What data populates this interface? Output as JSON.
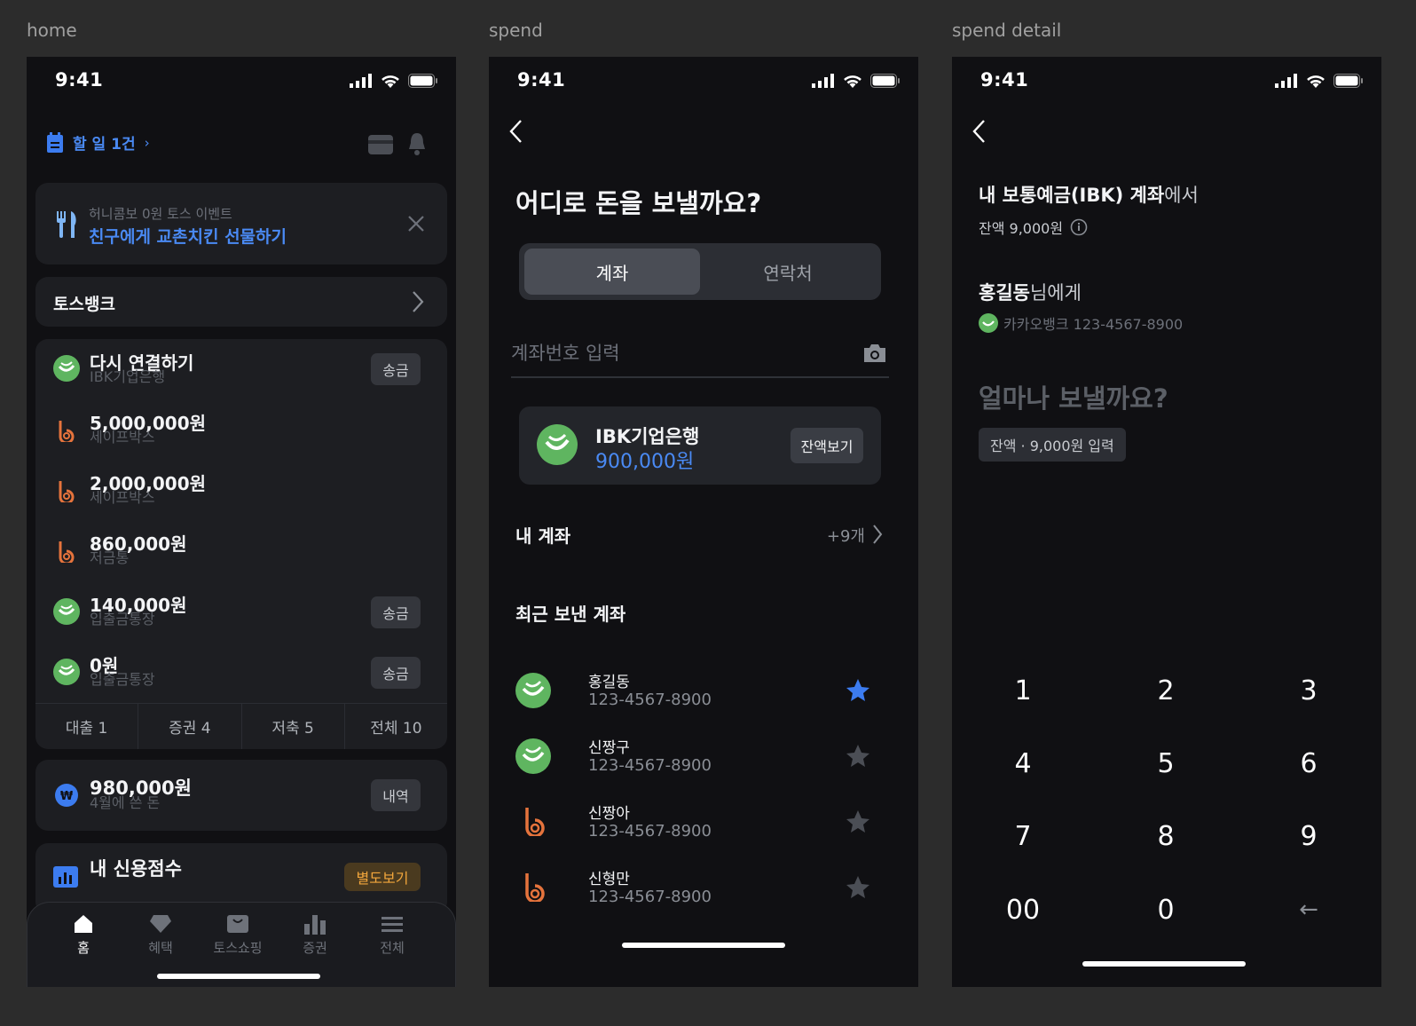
{
  "screens": {
    "home": {
      "label": "home",
      "time": "9:41",
      "todo": "할 일 1건",
      "banner": {
        "small": "허니콤보 0원 토스 이벤트",
        "main": "친구에게 교촌치킨 선물하기"
      },
      "bank_title": "토스뱅크",
      "accounts": [
        {
          "title": "다시 연결하기",
          "sub": "IBK기업은행",
          "action": "송금",
          "icon": "ibk-logo-icon"
        },
        {
          "title": "5,000,000원",
          "sub": "세이프박스",
          "icon": "safebox-logo-icon"
        },
        {
          "title": "2,000,000원",
          "sub": "세이프박스",
          "icon": "safebox-logo-icon"
        },
        {
          "title": "860,000원",
          "sub": "저금통",
          "icon": "safebox-logo-icon"
        },
        {
          "title": "140,000원",
          "sub": "입출금통장",
          "action": "송금",
          "icon": "ibk-logo-icon"
        },
        {
          "title": "0원",
          "sub": "입출금통장",
          "action": "송금",
          "icon": "ibk-logo-icon"
        }
      ],
      "categories": [
        "대출 1",
        "증권 4",
        "저축 5",
        "전체 10"
      ],
      "spend": {
        "title": "980,000원",
        "sub": "4월에 쓴 돈",
        "action": "내역"
      },
      "credit": {
        "title": "내 신용점수",
        "action": "별도보기"
      },
      "tabbar": [
        "홈",
        "혜택",
        "토스쇼핑",
        "증권",
        "전체"
      ]
    },
    "spend": {
      "label": "spend",
      "time": "9:41",
      "heading": "어디로 돈을 보낼까요?",
      "segments": [
        "계좌",
        "연락처"
      ],
      "input_placeholder": "계좌번호 입력",
      "account_card": {
        "bank": "IBK기업은행",
        "amount": "900,000원",
        "action": "잔액보기"
      },
      "my_accounts": {
        "title": "내 계좌",
        "more": "+9개"
      },
      "recent_title": "최근 보낸 계좌",
      "recent": [
        {
          "name": "홍길동",
          "number": "123-4567-8900",
          "starred": true,
          "icon": "ibk-logo-icon"
        },
        {
          "name": "신짱구",
          "number": "123-4567-8900",
          "starred": false,
          "icon": "ibk-logo-icon"
        },
        {
          "name": "신짱아",
          "number": "123-4567-8900",
          "starred": false,
          "icon": "safebox-logo-icon"
        },
        {
          "name": "신형만",
          "number": "123-4567-8900",
          "starred": false,
          "icon": "safebox-logo-icon"
        }
      ]
    },
    "detail": {
      "label": "spend detail",
      "time": "9:41",
      "from_strong": "내 보통예금(IBK) 계좌",
      "from_suffix": "에서",
      "balance": "잔액 9,000원",
      "to_name": "홍길동",
      "to_suffix": "님에게",
      "to_account": "카카오뱅크 123-4567-8900",
      "question": "얼마나 보낼까요?",
      "balance_chip": "잔액 · 9,000원 입력",
      "keys": [
        "1",
        "2",
        "3",
        "4",
        "5",
        "6",
        "7",
        "8",
        "9",
        "00",
        "0",
        "←"
      ]
    }
  },
  "colors": {
    "accent": "#4a8af4",
    "ibk_green": "#5fb560",
    "safebox_orange": "#e5733c",
    "credit_badge": "#f3a73c"
  }
}
